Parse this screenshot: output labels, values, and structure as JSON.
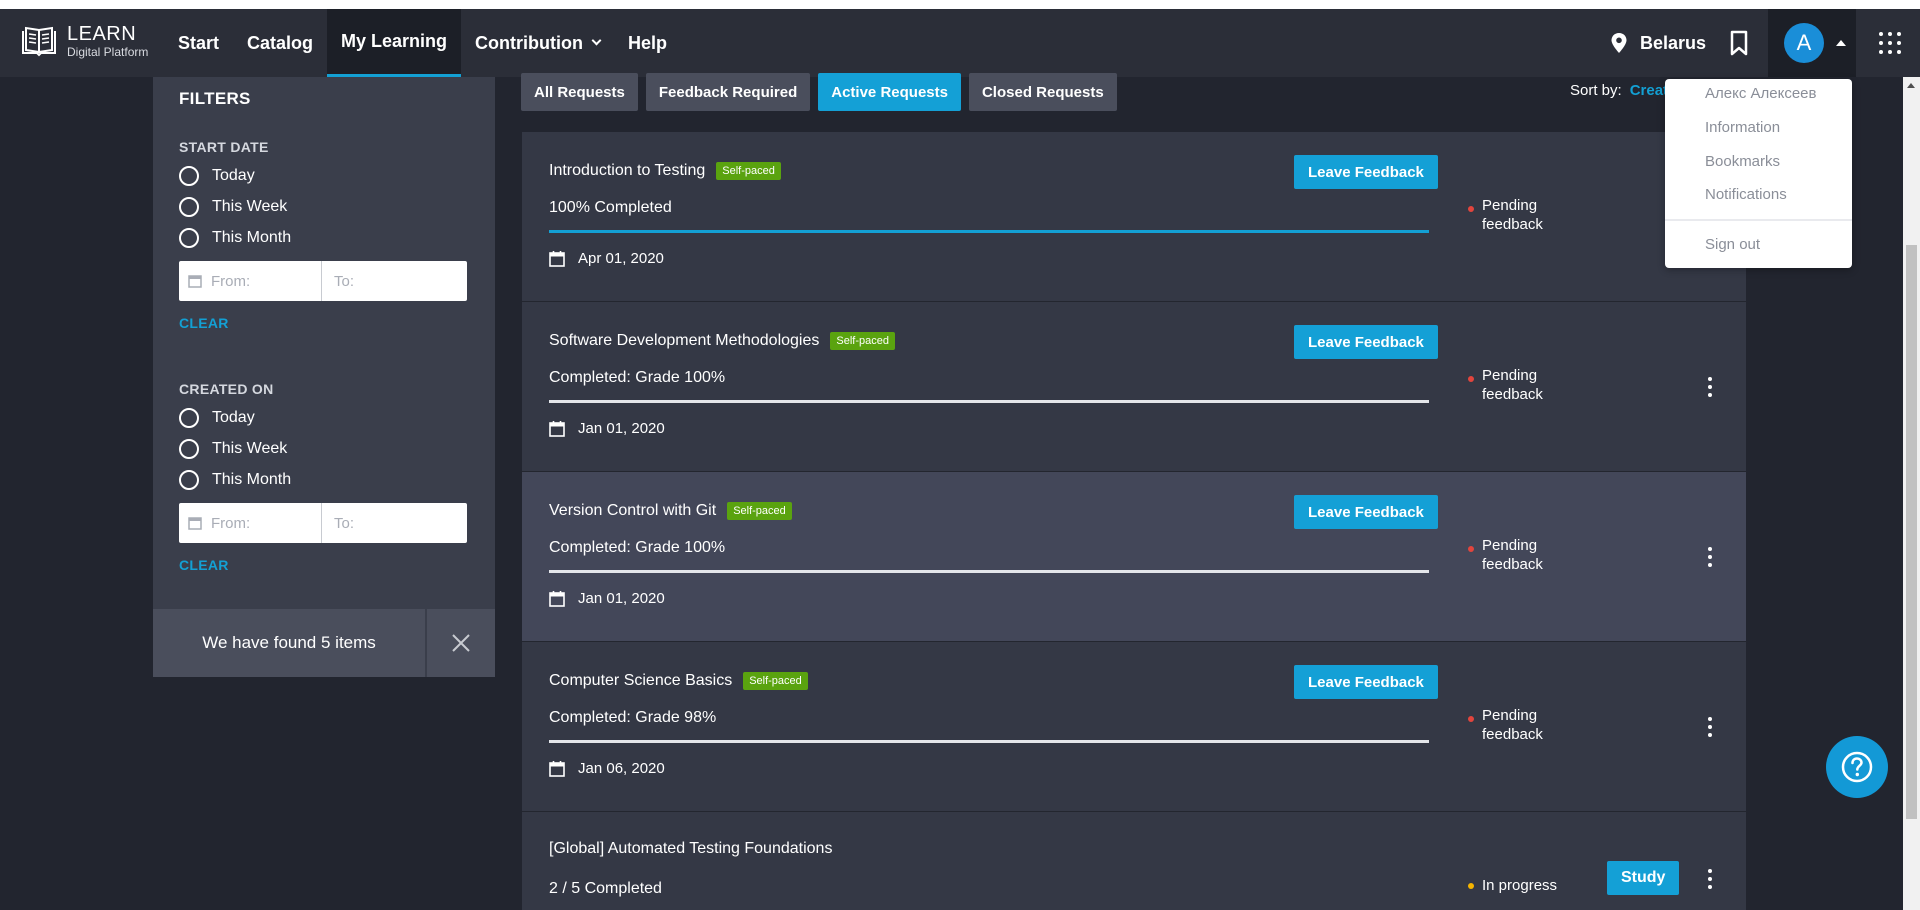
{
  "header": {
    "logo_title": "LEARN",
    "logo_subtitle": "Digital Platform",
    "nav": [
      {
        "label": "Start"
      },
      {
        "label": "Catalog"
      },
      {
        "label": "My Learning"
      },
      {
        "label": "Contribution"
      },
      {
        "label": "Help"
      }
    ],
    "location": "Belarus",
    "avatar_initial": "A"
  },
  "filters": {
    "title": "FILTERS",
    "start_date": {
      "heading": "START DATE",
      "options": [
        "Today",
        "This Week",
        "This Month"
      ],
      "from_placeholder": "From:",
      "to_placeholder": "To:",
      "clear": "CLEAR"
    },
    "created_on": {
      "heading": "CREATED ON",
      "options": [
        "Today",
        "This Week",
        "This Month"
      ],
      "from_placeholder": "From:",
      "to_placeholder": "To:",
      "clear": "CLEAR"
    },
    "found_text": "We have found 5 items"
  },
  "tabs": [
    {
      "label": "All Requests"
    },
    {
      "label": "Feedback Required"
    },
    {
      "label": "Active Requests"
    },
    {
      "label": "Closed Requests"
    }
  ],
  "active_tab": "Active Requests",
  "sort": {
    "label": "Sort by:",
    "value": "Creat"
  },
  "cards": [
    {
      "title": "Introduction to Testing",
      "badge": "Self-paced",
      "button": "Leave Feedback",
      "progress_text": "100% Completed",
      "progress": 1.0,
      "date": "Apr 01, 2020",
      "status": [
        "Pending",
        "feedback"
      ]
    },
    {
      "title": "Software Development Methodologies",
      "badge": "Self-paced",
      "button": "Leave Feedback",
      "progress_text": "Completed: Grade 100%",
      "progress": 0,
      "date": "Jan 01, 2020",
      "status": [
        "Pending",
        "feedback"
      ]
    },
    {
      "title": "Version Control with Git",
      "badge": "Self-paced",
      "button": "Leave Feedback",
      "progress_text": "Completed: Grade 100%",
      "progress": 0,
      "date": "Jan 01, 2020",
      "status": [
        "Pending",
        "feedback"
      ]
    },
    {
      "title": "Computer Science Basics",
      "badge": "Self-paced",
      "button": "Leave Feedback",
      "progress_text": "Completed: Grade 98%",
      "progress": 0,
      "date": "Jan 06, 2020",
      "status": [
        "Pending",
        "feedback"
      ]
    },
    {
      "title": "[Global] Automated Testing Foundations",
      "progress_text": "2 / 5 Completed",
      "status_text": "In progress",
      "button": "Study"
    }
  ],
  "user_menu": {
    "name": "Алекс Алексеев",
    "items": [
      "Information",
      "Bookmarks",
      "Notifications"
    ],
    "sign_out": "Sign out"
  },
  "colors": {
    "accent": "#14a0d6",
    "badge": "#5aa30f",
    "pending_dot": "#e2453d",
    "in_progress_dot": "#f5b400"
  }
}
